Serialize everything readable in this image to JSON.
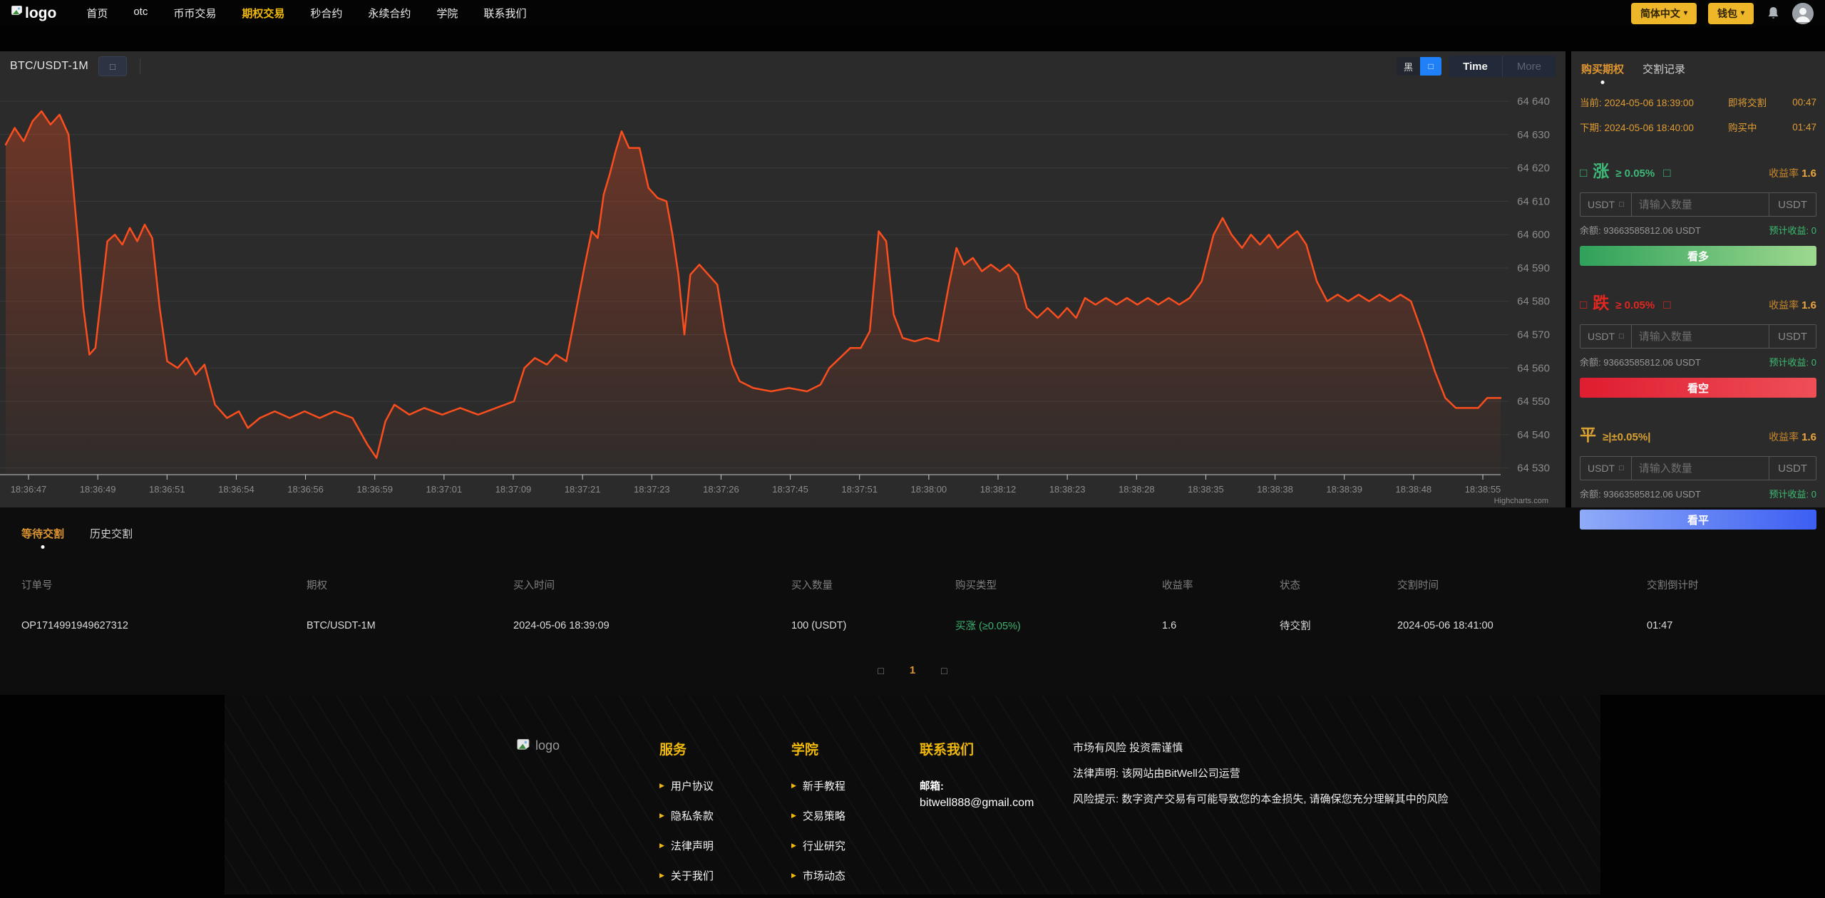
{
  "nav": {
    "logo_text": "logo",
    "items": [
      {
        "label": "首页"
      },
      {
        "label": "otc"
      },
      {
        "label": "币币交易"
      },
      {
        "label": "期权交易"
      },
      {
        "label": "秒合约"
      },
      {
        "label": "永续合约"
      },
      {
        "label": "学院"
      },
      {
        "label": "联系我们"
      }
    ],
    "language_button": "简体中文",
    "wallet_button": "钱包",
    "caret": "▾"
  },
  "chart": {
    "symbol": "BTC/USDT-1M",
    "symbol_button_glyph": "□",
    "theme_dark_label": "黑",
    "theme_light_label": "□",
    "time_button": "Time",
    "more_button": "More",
    "credit": "Highcharts.com",
    "line_color": "#fb4e1e",
    "grid_color": "#3a3a3a",
    "axis_color": "#c9c9c9",
    "label_color": "#8b8b8b",
    "y_ticks": [
      {
        "value": 64640,
        "label": "64 640"
      },
      {
        "value": 64630,
        "label": "64 630"
      },
      {
        "value": 64620,
        "label": "64 620"
      },
      {
        "value": 64610,
        "label": "64 610"
      },
      {
        "value": 64600,
        "label": "64 600"
      },
      {
        "value": 64590,
        "label": "64 590"
      },
      {
        "value": 64580,
        "label": "64 580"
      },
      {
        "value": 64570,
        "label": "64 570"
      },
      {
        "value": 64560,
        "label": "64 560"
      },
      {
        "value": 64550,
        "label": "64 550"
      },
      {
        "value": 64540,
        "label": "64 540"
      },
      {
        "value": 64530,
        "label": "64 530"
      }
    ],
    "x_labels": [
      "18:36:47",
      "18:36:49",
      "18:36:51",
      "18:36:54",
      "18:36:56",
      "18:36:59",
      "18:37:01",
      "18:37:09",
      "18:37:21",
      "18:37:23",
      "18:37:26",
      "18:37:45",
      "18:37:51",
      "18:38:00",
      "18:38:12",
      "18:38:23",
      "18:38:28",
      "18:38:35",
      "18:38:38",
      "18:38:39",
      "18:38:48",
      "18:38:55"
    ],
    "series": [
      [
        0.0,
        64627
      ],
      [
        0.006,
        64632
      ],
      [
        0.012,
        64628
      ],
      [
        0.018,
        64634
      ],
      [
        0.024,
        64637
      ],
      [
        0.03,
        64633
      ],
      [
        0.036,
        64636
      ],
      [
        0.042,
        64630
      ],
      [
        0.048,
        64600
      ],
      [
        0.052,
        64578
      ],
      [
        0.056,
        64564
      ],
      [
        0.06,
        64566
      ],
      [
        0.064,
        64582
      ],
      [
        0.068,
        64598
      ],
      [
        0.073,
        64600
      ],
      [
        0.078,
        64597
      ],
      [
        0.083,
        64602
      ],
      [
        0.088,
        64598
      ],
      [
        0.093,
        64603
      ],
      [
        0.098,
        64599
      ],
      [
        0.103,
        64578
      ],
      [
        0.108,
        64562
      ],
      [
        0.115,
        64560
      ],
      [
        0.121,
        64563
      ],
      [
        0.127,
        64558
      ],
      [
        0.133,
        64561
      ],
      [
        0.14,
        64549
      ],
      [
        0.148,
        64545
      ],
      [
        0.156,
        64547
      ],
      [
        0.162,
        64542
      ],
      [
        0.17,
        64545
      ],
      [
        0.18,
        64547
      ],
      [
        0.19,
        64545
      ],
      [
        0.2,
        64547
      ],
      [
        0.21,
        64545
      ],
      [
        0.22,
        64547
      ],
      [
        0.232,
        64545
      ],
      [
        0.242,
        64537
      ],
      [
        0.248,
        64533
      ],
      [
        0.254,
        64544
      ],
      [
        0.26,
        64549
      ],
      [
        0.27,
        64546
      ],
      [
        0.28,
        64548
      ],
      [
        0.292,
        64546
      ],
      [
        0.304,
        64548
      ],
      [
        0.316,
        64546
      ],
      [
        0.328,
        64548
      ],
      [
        0.34,
        64550
      ],
      [
        0.347,
        64560
      ],
      [
        0.354,
        64563
      ],
      [
        0.362,
        64561
      ],
      [
        0.368,
        64564
      ],
      [
        0.375,
        64562
      ],
      [
        0.381,
        64576
      ],
      [
        0.387,
        64590
      ],
      [
        0.392,
        64601
      ],
      [
        0.396,
        64599
      ],
      [
        0.4,
        64612
      ],
      [
        0.404,
        64618
      ],
      [
        0.408,
        64625
      ],
      [
        0.412,
        64631
      ],
      [
        0.417,
        64626
      ],
      [
        0.424,
        64626
      ],
      [
        0.43,
        64614
      ],
      [
        0.436,
        64611
      ],
      [
        0.442,
        64610
      ],
      [
        0.446,
        64600
      ],
      [
        0.45,
        64588
      ],
      [
        0.454,
        64570
      ],
      [
        0.458,
        64588
      ],
      [
        0.464,
        64591
      ],
      [
        0.47,
        64588
      ],
      [
        0.476,
        64585
      ],
      [
        0.481,
        64571
      ],
      [
        0.486,
        64561
      ],
      [
        0.491,
        64556
      ],
      [
        0.5,
        64554
      ],
      [
        0.512,
        64553
      ],
      [
        0.524,
        64554
      ],
      [
        0.536,
        64553
      ],
      [
        0.545,
        64555
      ],
      [
        0.551,
        64560
      ],
      [
        0.558,
        64563
      ],
      [
        0.565,
        64566
      ],
      [
        0.572,
        64566
      ],
      [
        0.578,
        64571
      ],
      [
        0.584,
        64601
      ],
      [
        0.589,
        64598
      ],
      [
        0.594,
        64576
      ],
      [
        0.6,
        64569
      ],
      [
        0.608,
        64568
      ],
      [
        0.616,
        64569
      ],
      [
        0.624,
        64568
      ],
      [
        0.631,
        64585
      ],
      [
        0.636,
        64596
      ],
      [
        0.641,
        64591
      ],
      [
        0.647,
        64593
      ],
      [
        0.653,
        64589
      ],
      [
        0.659,
        64591
      ],
      [
        0.665,
        64589
      ],
      [
        0.671,
        64591
      ],
      [
        0.677,
        64588
      ],
      [
        0.683,
        64578
      ],
      [
        0.69,
        64575
      ],
      [
        0.697,
        64578
      ],
      [
        0.704,
        64575
      ],
      [
        0.71,
        64578
      ],
      [
        0.716,
        64575
      ],
      [
        0.722,
        64581
      ],
      [
        0.729,
        64579
      ],
      [
        0.736,
        64581
      ],
      [
        0.743,
        64579
      ],
      [
        0.75,
        64581
      ],
      [
        0.757,
        64579
      ],
      [
        0.764,
        64581
      ],
      [
        0.771,
        64579
      ],
      [
        0.778,
        64581
      ],
      [
        0.785,
        64579
      ],
      [
        0.792,
        64581
      ],
      [
        0.8,
        64586
      ],
      [
        0.808,
        64600
      ],
      [
        0.814,
        64605
      ],
      [
        0.82,
        64600
      ],
      [
        0.827,
        64596
      ],
      [
        0.833,
        64600
      ],
      [
        0.839,
        64597
      ],
      [
        0.845,
        64600
      ],
      [
        0.851,
        64596
      ],
      [
        0.858,
        64599
      ],
      [
        0.864,
        64601
      ],
      [
        0.87,
        64597
      ],
      [
        0.877,
        64586
      ],
      [
        0.884,
        64580
      ],
      [
        0.891,
        64582
      ],
      [
        0.898,
        64580
      ],
      [
        0.905,
        64582
      ],
      [
        0.912,
        64580
      ],
      [
        0.919,
        64582
      ],
      [
        0.926,
        64580
      ],
      [
        0.933,
        64582
      ],
      [
        0.94,
        64580
      ],
      [
        0.948,
        64570
      ],
      [
        0.956,
        64559
      ],
      [
        0.963,
        64551
      ],
      [
        0.97,
        64548
      ],
      [
        0.978,
        64548
      ],
      [
        0.985,
        64548
      ],
      [
        0.991,
        64551
      ],
      [
        1.0,
        64551
      ]
    ]
  },
  "trade": {
    "tabs": [
      {
        "label": "购买期权"
      },
      {
        "label": "交割记录"
      }
    ],
    "info_rows": [
      {
        "label": "当前:",
        "time": "2024-05-06 18:39:00",
        "status": "即将交割",
        "countdown": "00:47"
      },
      {
        "label": "下期:",
        "time": "2024-05-06 18:40:00",
        "status": "购买中",
        "countdown": "01:47"
      }
    ],
    "sections": [
      {
        "box": "□",
        "name": "涨",
        "condition": "≥ 0.05%",
        "rate_label": "收益率",
        "rate": "1.6",
        "unit_select": "USDT",
        "unit_caret": "□",
        "placeholder": "请输入数量",
        "unit": "USDT",
        "balance_label": "余额:",
        "balance": "93663585812.06 USDT",
        "profit_label": "预计收益:",
        "profit": "0",
        "button": "看多"
      },
      {
        "box": "□",
        "name": "跌",
        "condition": "≥ 0.05%",
        "rate_label": "收益率",
        "rate": "1.6",
        "unit_select": "USDT",
        "unit_caret": "□",
        "placeholder": "请输入数量",
        "unit": "USDT",
        "balance_label": "余额:",
        "balance": "93663585812.06 USDT",
        "profit_label": "预计收益:",
        "profit": "0",
        "button": "看空"
      },
      {
        "name": "平",
        "condition": "≥|±0.05%|",
        "rate_label": "收益率",
        "rate": "1.6",
        "unit_select": "USDT",
        "unit_caret": "□",
        "placeholder": "请输入数量",
        "unit": "USDT",
        "balance_label": "余额:",
        "balance": "93663585812.06 USDT",
        "profit_label": "预计收益:",
        "profit": "0",
        "button": "看平"
      }
    ]
  },
  "orders": {
    "tabs": [
      {
        "label": "等待交割"
      },
      {
        "label": "历史交割"
      }
    ],
    "headers": [
      "订单号",
      "期权",
      "买入时间",
      "买入数量",
      "购买类型",
      "收益率",
      "状态",
      "交割时间",
      "交割倒计时"
    ],
    "rows": [
      {
        "order_id": "OP1714991949627312",
        "option": "BTC/USDT-1M",
        "buy_time": "2024-05-06 18:39:09",
        "amount": "100 (USDT)",
        "type": "买涨 (≥0.05%)",
        "rate": "1.6",
        "status": "待交割",
        "settle_time": "2024-05-06 18:41:00",
        "countdown": "01:47"
      }
    ],
    "pagination": {
      "prev": "□",
      "page": "1",
      "next": "□"
    }
  },
  "footer": {
    "logo_text": "logo",
    "bullet": "▶",
    "columns": [
      {
        "title": "服务",
        "items": [
          "用户协议",
          "隐私条款",
          "法律声明",
          "关于我们"
        ]
      },
      {
        "title": "学院",
        "items": [
          "新手教程",
          "交易策略",
          "行业研究",
          "市场动态"
        ]
      }
    ],
    "contact": {
      "title": "联系我们",
      "email_label": "邮箱:",
      "email": "bitwell888@gmail.com"
    },
    "disclaimers": [
      "市场有风险 投资需谨慎",
      "法律声明: 该网站由BitWell公司运营",
      "风险提示: 数字资产交易有可能导致您的本金损失, 请确保您充分理解其中的风险"
    ]
  }
}
